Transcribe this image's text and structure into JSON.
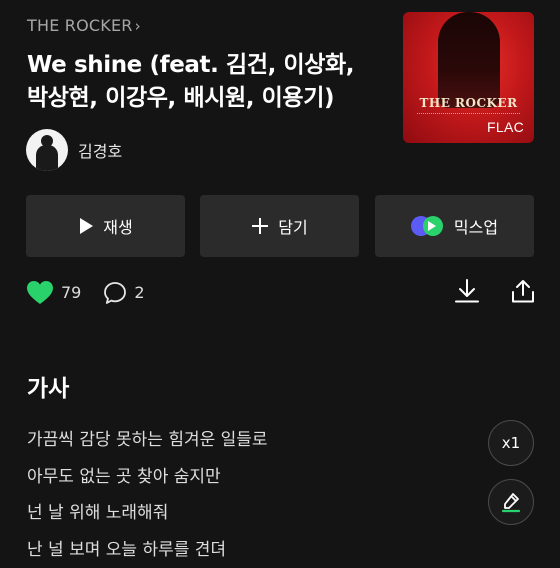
{
  "album": {
    "title": "THE ROCKER"
  },
  "track": {
    "title": "We shine (feat. 김건, 이상화, 박상현, 이강우, 배시원, 이용기)"
  },
  "cover": {
    "title": "THE ROCKER",
    "badge": "FLAC"
  },
  "artist": {
    "name": "김경호"
  },
  "actions": {
    "play_label": "재생",
    "add_label": "담기",
    "mix_label": "믹스업"
  },
  "stats": {
    "likes": "79",
    "comments": "2"
  },
  "lyrics": {
    "heading": "가사",
    "lines": [
      "가끔씩 감당 못하는 힘겨운 일들로",
      "아무도 없는 곳 찾아 숨지만",
      "넌 날 위해 노래해줘",
      "난 널 보며 오늘 하루를 견뎌"
    ],
    "speed_label": "x1"
  },
  "colors": {
    "background": "#141414",
    "like_green": "#2ad26b",
    "button_bg": "#2b2b2b",
    "mix_purple": "#5d5bf6"
  },
  "icons": {
    "album_link": "chevron-right-icon",
    "play": "play-icon",
    "add": "plus-icon",
    "mix": "mixup-icon",
    "like": "heart-icon",
    "comment": "comment-bubble-icon",
    "download": "download-icon",
    "share": "share-icon",
    "highlight": "highlighter-icon"
  }
}
